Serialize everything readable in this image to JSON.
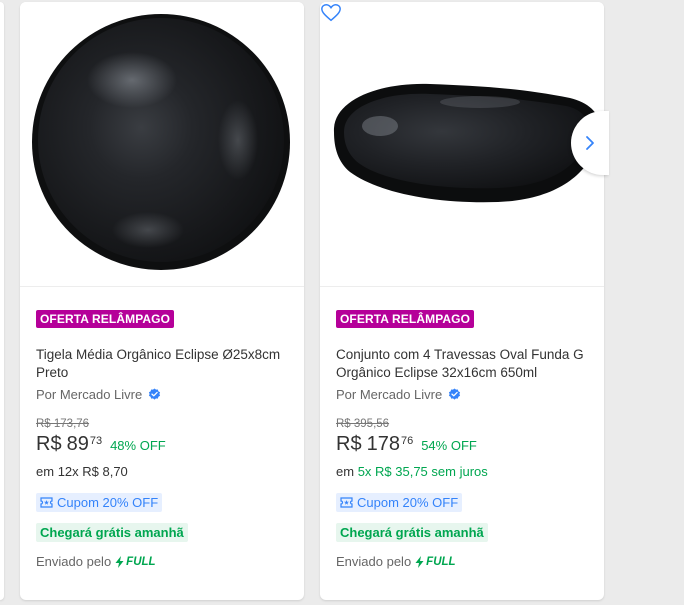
{
  "products": [
    {
      "badge": "OFERTA RELÂMPAGO",
      "title": "Tigela Média Orgânico Eclipse Ø25x8cm Preto",
      "seller": "Por Mercado Livre",
      "old_price": "R$ 173,76",
      "currency": "R$",
      "price_int": "89",
      "price_cents": "73",
      "discount": "48% OFF",
      "installments_prefix": "em",
      "installments_value": "12x R$ 8,70",
      "installments_green": false,
      "coupon": "Cupom 20% OFF",
      "shipping": "Chegará grátis amanhã",
      "sent_by": "Enviado pelo",
      "full": "FULL",
      "image_icon": "bowl-image"
    },
    {
      "badge": "OFERTA RELÂMPAGO",
      "title": "Conjunto com 4 Travessas Oval Funda G Orgânico Eclipse 32x16cm 650ml",
      "seller": "Por Mercado Livre",
      "old_price": "R$ 395,56",
      "currency": "R$",
      "price_int": "178",
      "price_cents": "76",
      "discount": "54% OFF",
      "installments_prefix": "em",
      "installments_value": "5x R$ 35,75 sem juros",
      "installments_green": true,
      "coupon": "Cupom 20% OFF",
      "shipping": "Chegará grátis amanhã",
      "sent_by": "Enviado pelo",
      "full": "FULL",
      "image_icon": "oval-dish-image"
    }
  ],
  "icons": {
    "favorite": "heart-icon",
    "next": "chevron-right-icon",
    "verified": "verified-check-icon",
    "coupon": "coupon-icon",
    "full": "lightning-icon"
  },
  "colors": {
    "badge": "#b50099",
    "green": "#00a650",
    "blue": "#3483fa",
    "background": "#ebebeb"
  }
}
